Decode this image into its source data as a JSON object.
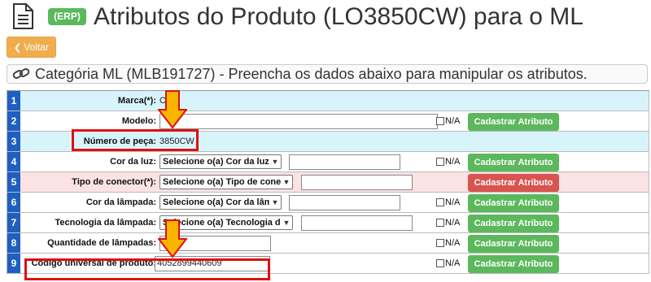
{
  "header": {
    "badge": "(ERP)",
    "title": "Atributos do Produto (LO3850CW) para o ML",
    "icon": "document-icon"
  },
  "back_button": {
    "label": "Voltar",
    "icon": "chevron-left-icon"
  },
  "category": {
    "icon": "link-icon",
    "text": "Categória ML (MLB191727) - Preencha os dados abaixo para manipular os atributos."
  },
  "na_label": "N/A",
  "cadastrar_label": "Cadastrar Atributo",
  "rows": [
    {
      "num": "1",
      "label": "Marca(*):",
      "value": "OS"
    },
    {
      "num": "2",
      "label": "Modelo:",
      "value": ""
    },
    {
      "num": "3",
      "label": "Número de peça:",
      "value": "3850CW"
    },
    {
      "num": "4",
      "label": "Cor da luz:",
      "select": "Selecione o(a) Cor da luz",
      "value": ""
    },
    {
      "num": "5",
      "label": "Tipo de conector(*):",
      "select": "Selecione o(a) Tipo de conector",
      "value": ""
    },
    {
      "num": "6",
      "label": "Cor da lâmpada:",
      "select": "Selecione o(a) Cor da lâmpada",
      "value": ""
    },
    {
      "num": "7",
      "label": "Tecnologia da lâmpada:",
      "select": "Selecione o(a) Tecnologia da lâmpada",
      "value": ""
    },
    {
      "num": "8",
      "label": "Quantidade de lâmpadas:",
      "value": ""
    },
    {
      "num": "9",
      "label": "Código universal de produto:",
      "value": "4052899440609"
    }
  ],
  "colors": {
    "success": "#5cb85c",
    "danger": "#d9534f",
    "warning": "#f0ad4e",
    "row_number": "#1f5fbf",
    "row_info": "#d7f4fb",
    "row_required": "#fbe3e3",
    "highlight": "#e01010",
    "arrow": "#f7b500"
  }
}
